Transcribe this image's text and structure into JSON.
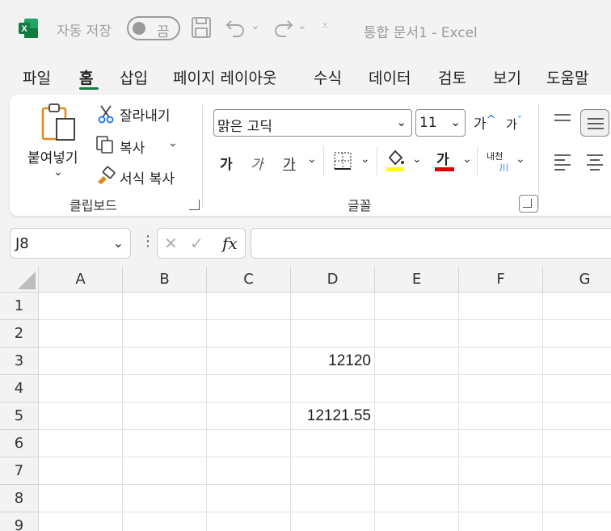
{
  "titlebar": {
    "autosave_label": "자동 저장",
    "autosave_state": "끔",
    "document_title": "통합 문서1  -  Excel",
    "app_icon": "excel-logo",
    "brand_color": "#107c41"
  },
  "tabs": [
    {
      "label": "파일",
      "active": false
    },
    {
      "label": "홈",
      "active": true
    },
    {
      "label": "삽입",
      "active": false
    },
    {
      "label": "페이지 레이아웃",
      "active": false
    },
    {
      "label": "수식",
      "active": false
    },
    {
      "label": "데이터",
      "active": false
    },
    {
      "label": "검토",
      "active": false
    },
    {
      "label": "보기",
      "active": false
    },
    {
      "label": "도움말",
      "active": false
    }
  ],
  "ribbon": {
    "clipboard": {
      "paste_label": "붙여넣기",
      "cut_label": "잘라내기",
      "copy_label": "복사",
      "format_painter_label": "서식 복사",
      "group_label": "클립보드"
    },
    "font": {
      "font_name": "맑은 고딕",
      "font_size": "11",
      "bold_glyph": "가",
      "italic_glyph": "가",
      "underline_glyph": "가",
      "grow_glyph": "가",
      "shrink_glyph": "가",
      "font_color_glyph": "가",
      "phonetic_glyph": "내천",
      "phonetic_sub": "川",
      "group_label": "글꼴",
      "fill_color": "#ffff00",
      "font_color": "#e00000"
    }
  },
  "formula_bar": {
    "name_box": "J8",
    "fx_label": "fx",
    "formula": ""
  },
  "sheet": {
    "columns": [
      "A",
      "B",
      "C",
      "D",
      "E",
      "F",
      "G"
    ],
    "rows": [
      "1",
      "2",
      "3",
      "4",
      "5",
      "6",
      "7",
      "8",
      "9"
    ],
    "cells": [
      {
        "ref": "D3",
        "value": "12120"
      },
      {
        "ref": "D5",
        "value": "12121.55"
      }
    ]
  }
}
